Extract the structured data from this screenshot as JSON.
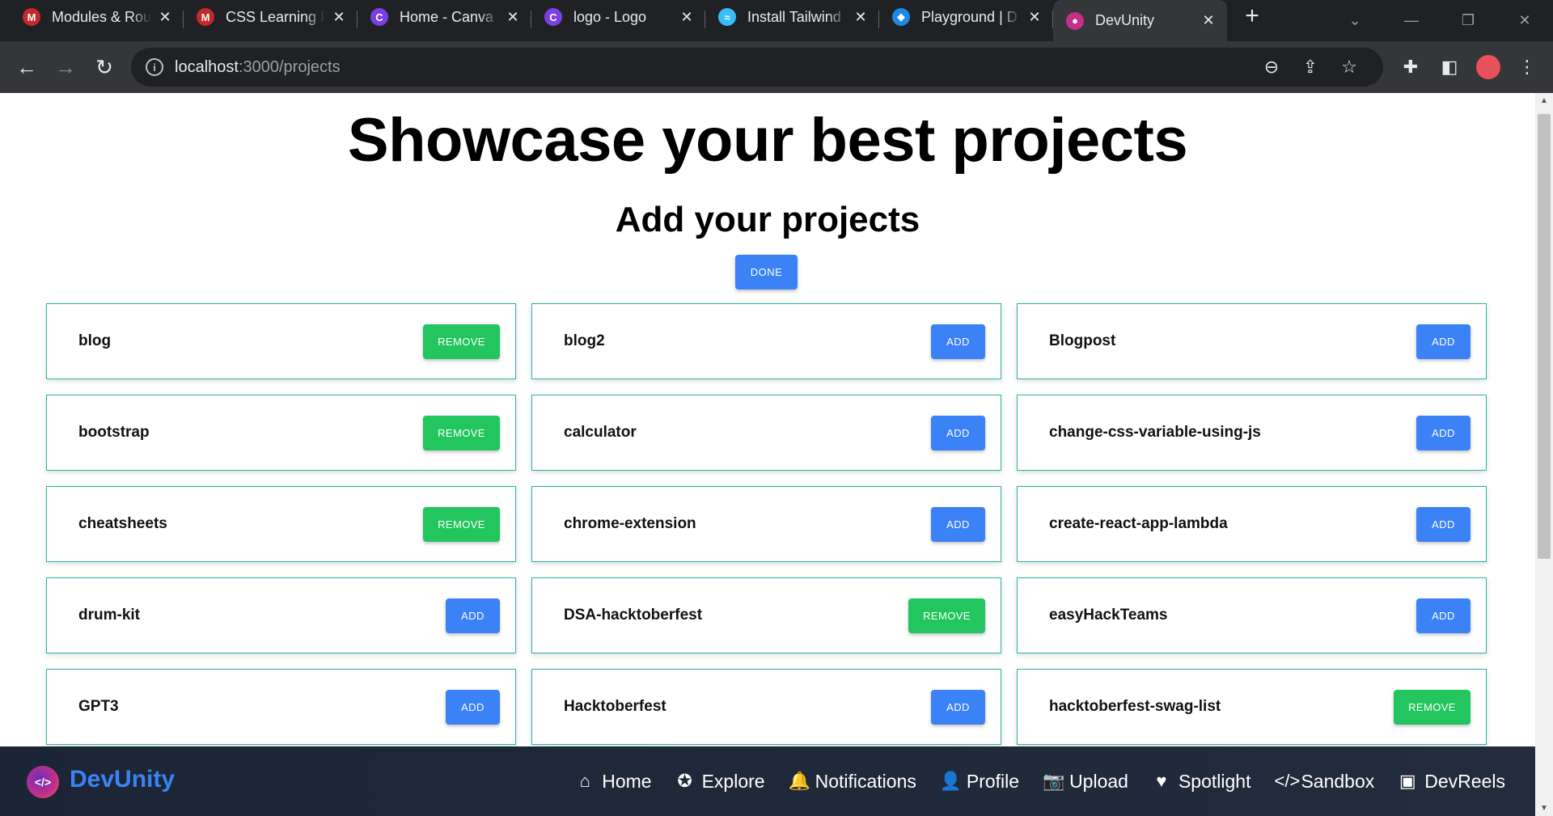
{
  "browser": {
    "tabs": [
      {
        "title": "Modules & Rou",
        "icon": "m-logo-icon",
        "color": "#c62828",
        "glyph": "M"
      },
      {
        "title": "CSS Learning P",
        "icon": "m-logo-icon",
        "color": "#c62828",
        "glyph": "M"
      },
      {
        "title": "Home - Canva",
        "icon": "canva-icon",
        "color": "#7b3fe4",
        "glyph": "C"
      },
      {
        "title": "logo - Logo",
        "icon": "canva-icon",
        "color": "#7b3fe4",
        "glyph": "C"
      },
      {
        "title": "Install Tailwind",
        "icon": "tailwind-icon",
        "color": "#38bdf8",
        "glyph": "≈"
      },
      {
        "title": "Playground | D",
        "icon": "playground-icon",
        "color": "#1e88e5",
        "glyph": "◆"
      },
      {
        "title": "DevUnity",
        "icon": "devunity-icon",
        "color": "#c42f8a",
        "glyph": "●"
      }
    ],
    "active_tab": 6,
    "url_host": "localhost",
    "url_path": ":3000/projects"
  },
  "page": {
    "title": "Showcase your best projects",
    "subtitle": "Add your projects",
    "done_label": "DONE"
  },
  "projects": [
    {
      "name": "blog",
      "action": "REMOVE"
    },
    {
      "name": "blog2",
      "action": "ADD"
    },
    {
      "name": "Blogpost",
      "action": "ADD"
    },
    {
      "name": "bootstrap",
      "action": "REMOVE"
    },
    {
      "name": "calculator",
      "action": "ADD"
    },
    {
      "name": "change-css-variable-using-js",
      "action": "ADD"
    },
    {
      "name": "cheatsheets",
      "action": "REMOVE"
    },
    {
      "name": "chrome-extension",
      "action": "ADD"
    },
    {
      "name": "create-react-app-lambda",
      "action": "ADD"
    },
    {
      "name": "drum-kit",
      "action": "ADD"
    },
    {
      "name": "DSA-hacktoberfest",
      "action": "REMOVE"
    },
    {
      "name": "easyHackTeams",
      "action": "ADD"
    },
    {
      "name": "GPT3",
      "action": "ADD"
    },
    {
      "name": "Hacktoberfest",
      "action": "ADD"
    },
    {
      "name": "hacktoberfest-swag-list",
      "action": "REMOVE"
    }
  ],
  "colors": {
    "add": "#3b82f6",
    "remove": "#22c55e",
    "card_border": "#2ab5a5",
    "brand": "#3b82f6"
  },
  "nav": {
    "brand": "DevUnity",
    "links": [
      {
        "label": "Home",
        "icon": "home-icon",
        "glyph": "⌂"
      },
      {
        "label": "Explore",
        "icon": "compass-icon",
        "glyph": "✪"
      },
      {
        "label": "Notifications",
        "icon": "bell-icon",
        "glyph": "🔔"
      },
      {
        "label": "Profile",
        "icon": "user-icon",
        "glyph": "👤"
      },
      {
        "label": "Upload",
        "icon": "camera-icon",
        "glyph": "📷"
      },
      {
        "label": "Spotlight",
        "icon": "heart-icon",
        "glyph": "♥"
      },
      {
        "label": "Sandbox",
        "icon": "code-icon",
        "glyph": "</>"
      },
      {
        "label": "DevReels",
        "icon": "reels-icon",
        "glyph": "▣"
      }
    ]
  }
}
